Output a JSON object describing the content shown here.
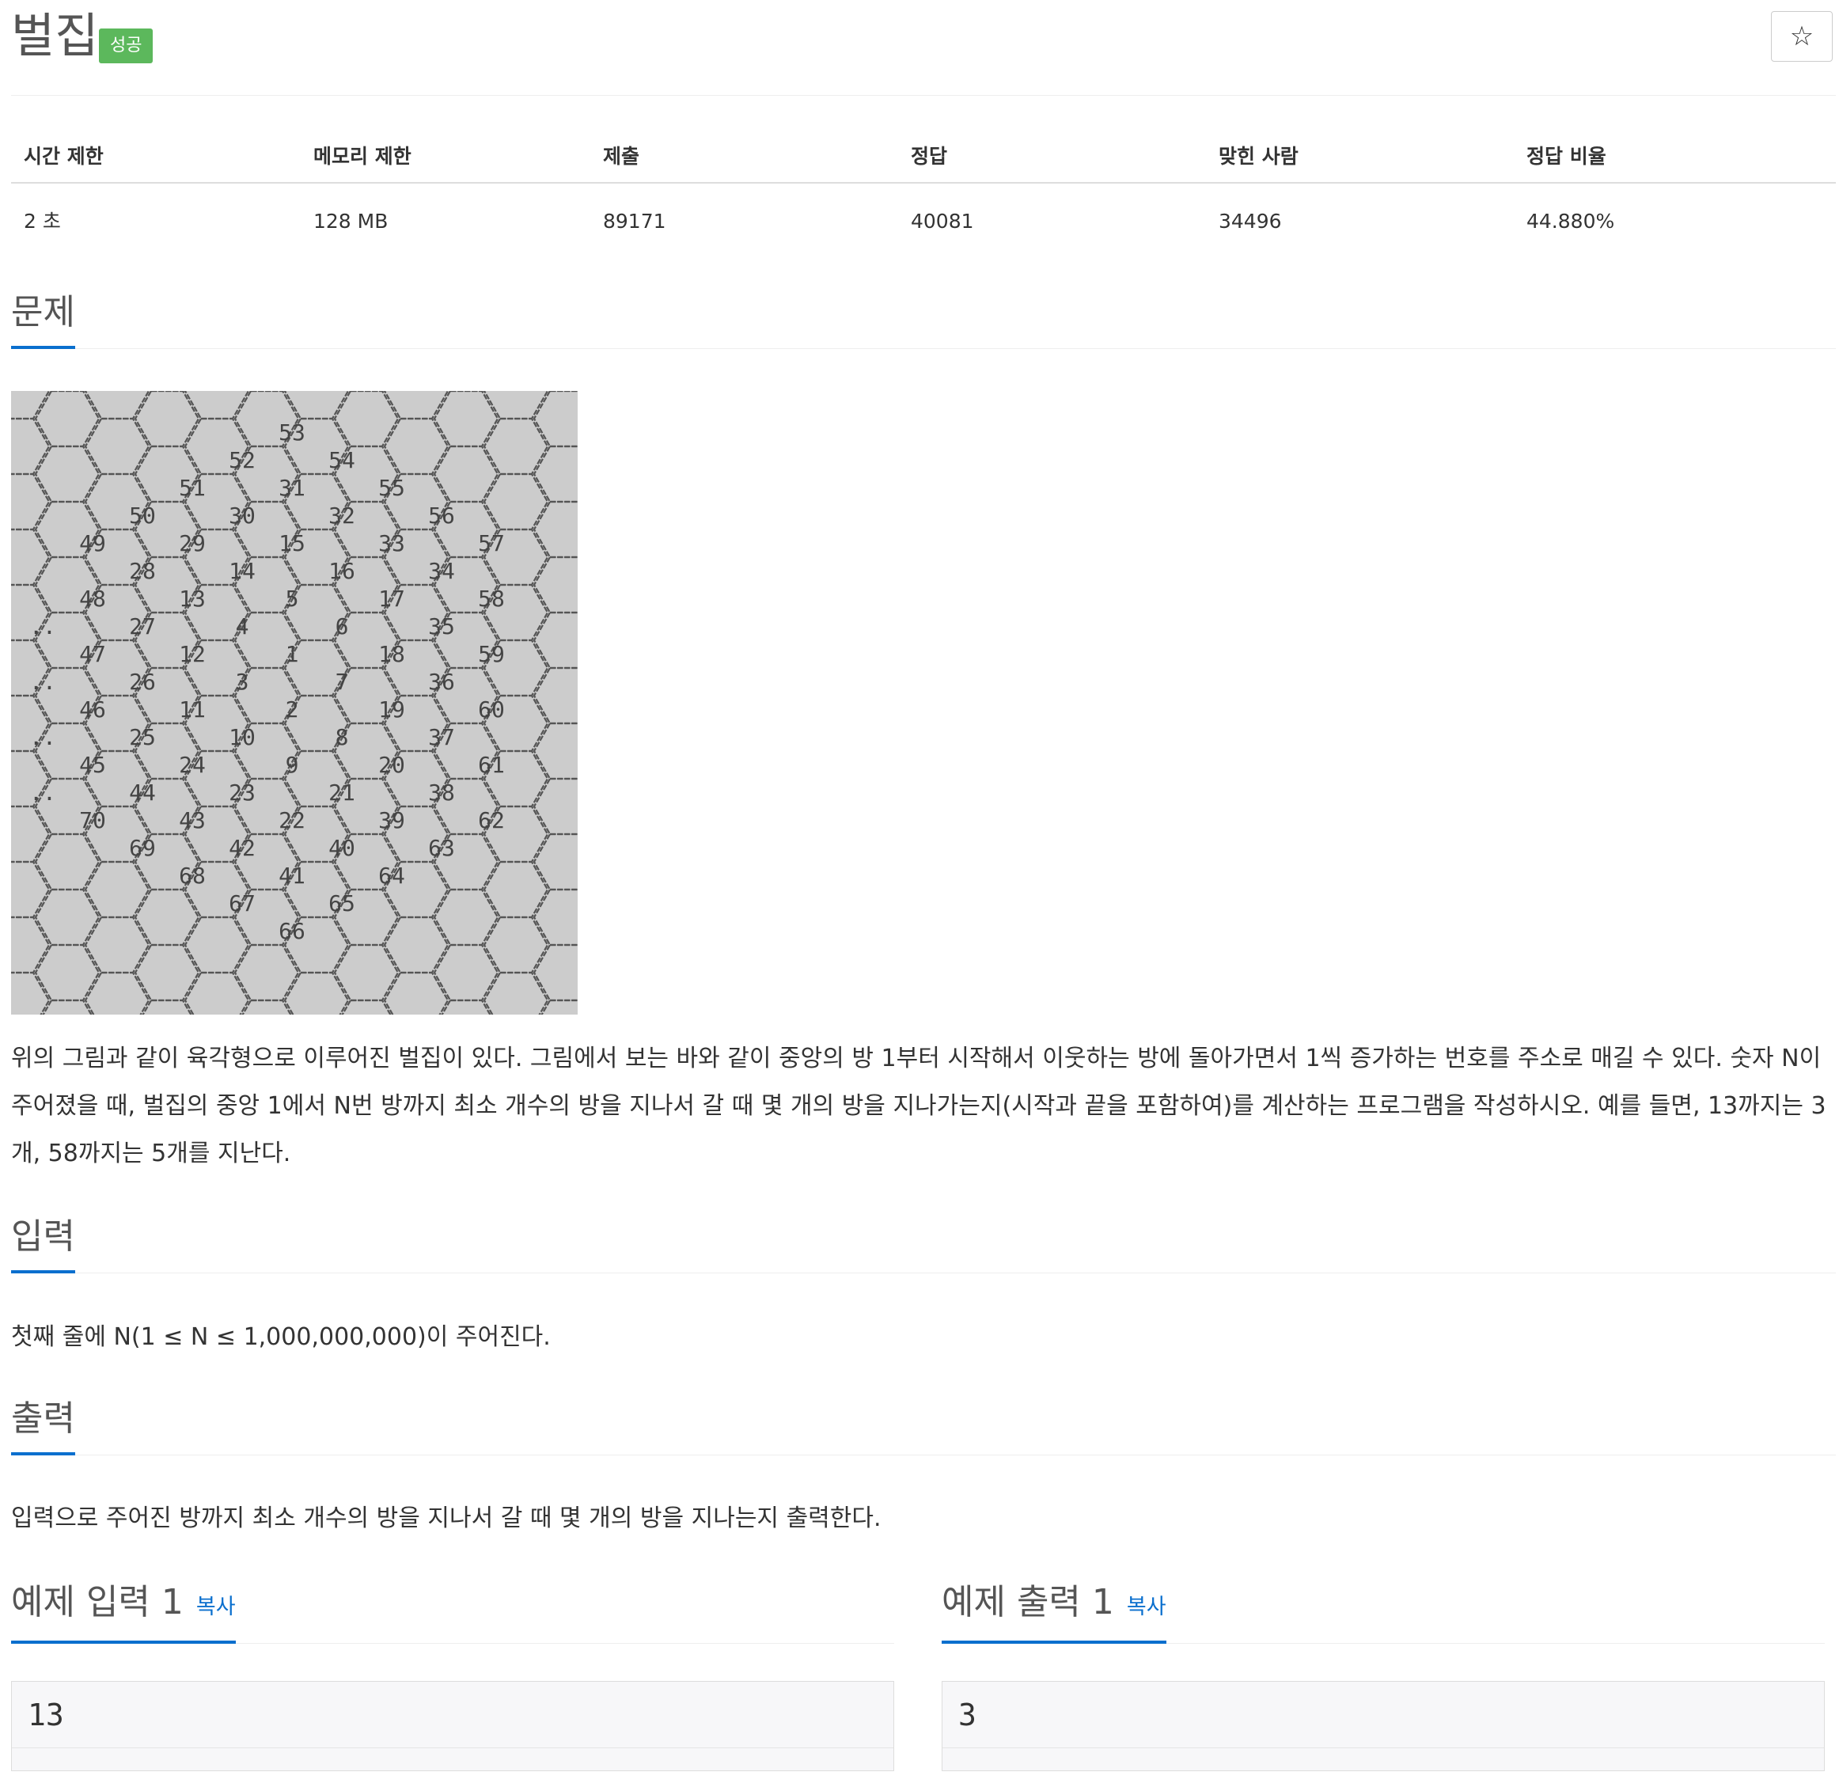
{
  "problem": {
    "title": "벌집",
    "status_badge": "성공",
    "star_label": "☆"
  },
  "stats": {
    "headers": [
      "시간 제한",
      "메모리 제한",
      "제출",
      "정답",
      "맞힌 사람",
      "정답 비율"
    ],
    "values": [
      "2 초",
      "128 MB",
      "89171",
      "40081",
      "34496",
      "44.880%"
    ]
  },
  "sections": {
    "problem_heading": "문제",
    "input_heading": "입력",
    "output_heading": "출력"
  },
  "description": {
    "line1": "위의 그림과 같이 육각형으로 이루어진 벌집이 있다. 그림에서 보는 바와 같이 중앙의 방 1부터 시작해서 이웃하는 방에 돌아가면서 1씩 증가하는 번호를 주소로 매길 수 있다. 숫자 N이",
    "line2": "주어졌을 때, 벌집의 중앙 1에서 N번 방까지 최소 개수의 방을 지나서 갈 때 몇 개의 방을 지나가는지(시작과 끝을 포함하여)를 계산하는 프로그램을 작성하시오. 예를 들면, 13까지는 3",
    "line3": "개, 58까지는 5개를 지난다."
  },
  "input_text": "첫째 줄에 N(1 ≤ N ≤ 1,000,000,000)이 주어진다.",
  "output_text": "입력으로 주어진 방까지 최소 개수의 방을 지나서 갈 때 몇 개의 방을 지나는지 출력한다.",
  "samples": {
    "input_title": "예제 입력 1",
    "output_title": "예제 출력 1",
    "copy_label": "복사",
    "input_value": "13",
    "output_value": "3"
  },
  "honeycomb": {
    "labels": [
      "53",
      "52",
      "54",
      "51",
      "31",
      "55",
      "50",
      "30",
      "32",
      "56",
      "49",
      "29",
      "15",
      "33",
      "57",
      "28",
      "14",
      "16",
      "34",
      "48",
      "13",
      "5",
      "17",
      "58",
      "..",
      "27",
      "4",
      "6",
      "35",
      "47",
      "12",
      "1",
      "18",
      "59",
      "..",
      "26",
      "3",
      "7",
      "36",
      "46",
      "11",
      "2",
      "19",
      "60",
      "..",
      "25",
      "10",
      "8",
      "37",
      "45",
      "24",
      "9",
      "20",
      "61",
      "..",
      "44",
      "23",
      "21",
      "38",
      "70",
      "43",
      "22",
      "39",
      "62",
      "69",
      "42",
      "40",
      "63",
      "68",
      "41",
      "64",
      "67",
      "65",
      "66"
    ]
  }
}
